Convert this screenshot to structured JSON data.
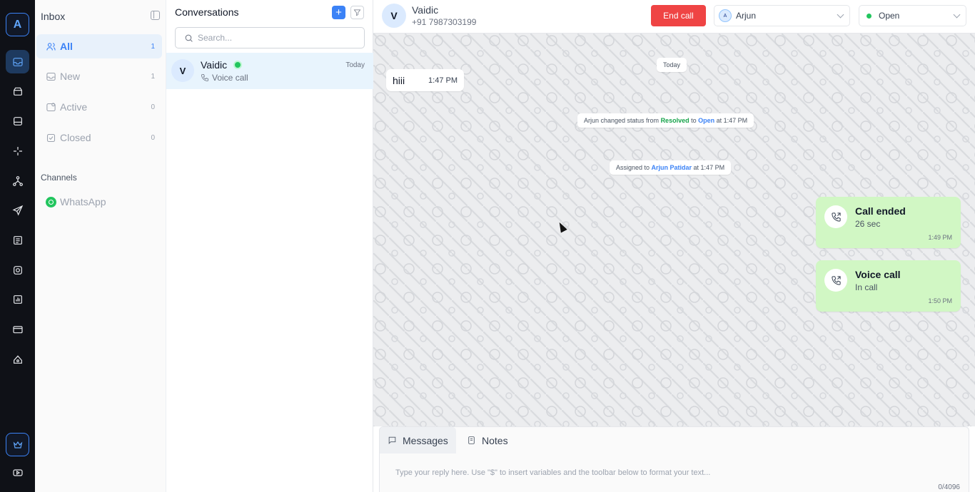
{
  "rail": {
    "logo": "A",
    "items": [
      "inbox-icon",
      "contacts-icon",
      "archive-icon",
      "ai-sparkle-icon",
      "flows-icon",
      "broadcast-icon",
      "templates-icon",
      "instagram-icon",
      "analytics-icon",
      "billing-icon",
      "integrations-icon"
    ],
    "bottom": [
      "crown-icon",
      "video-icon"
    ]
  },
  "inbox": {
    "title": "Inbox",
    "items": [
      {
        "label": "All",
        "count": "1",
        "icon": "users-icon",
        "active": true
      },
      {
        "label": "New",
        "count": "1",
        "icon": "inbox-icon"
      },
      {
        "label": "Active",
        "count": "0",
        "icon": "active-icon"
      },
      {
        "label": "Closed",
        "count": "0",
        "icon": "check-square-icon"
      }
    ],
    "channels_label": "Channels",
    "channel": "WhatsApp"
  },
  "conversations": {
    "title": "Conversations",
    "add": "+",
    "search_placeholder": "Search...",
    "items": [
      {
        "avatar": "V",
        "name": "Vaidic",
        "subtitle": "Voice call",
        "time": "Today"
      }
    ]
  },
  "header": {
    "avatar": "V",
    "name": "Vaidic",
    "phone": "+91 7987303199",
    "end_call": "End call",
    "assignee_initial": "A",
    "assignee": "Arjun",
    "status": "Open"
  },
  "chat": {
    "date_pill": "Today",
    "incoming": {
      "text": "hiii",
      "time": "1:47 PM"
    },
    "status_change": {
      "prefix": "Arjun changed status from ",
      "from": "Resolved",
      "mid": " to ",
      "to": "Open",
      "suffix": " at 1:47 PM"
    },
    "assignment": {
      "prefix": "Assigned to ",
      "who": "Arjun Patidar",
      "suffix": " at 1:47 PM"
    },
    "calls": [
      {
        "title": "Call ended",
        "sub": "26 sec",
        "time": "1:49 PM"
      },
      {
        "title": "Voice call",
        "sub": "In call",
        "time": "1:50 PM"
      }
    ]
  },
  "composer": {
    "tab_messages": "Messages",
    "tab_notes": "Notes",
    "placeholder": "Type your reply here. Use \"$\" to insert variables and the toolbar below to format your text...",
    "counter": "0/4096"
  },
  "colors": {
    "accent": "#3b82f6",
    "danger": "#ef4444",
    "online": "#22c55e",
    "call_bubble": "#d1f7c4"
  }
}
